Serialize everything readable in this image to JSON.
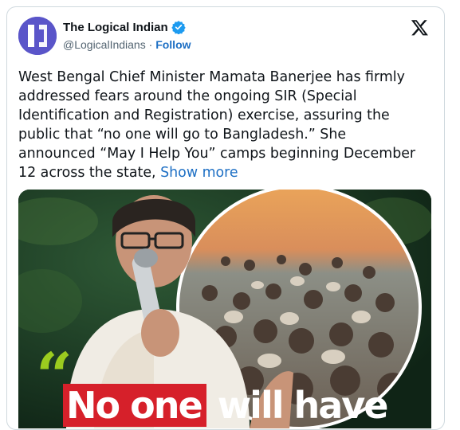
{
  "author": {
    "display_name": "The Logical Indian",
    "handle": "@LogicalIndians",
    "separator": "·",
    "follow_label": "Follow",
    "verified": true,
    "avatar_color": "#5a55c9"
  },
  "platform_logo": "x-logo",
  "tweet": {
    "lines": [
      "West Bengal Chief Minister Mamata Banerjee has firmly",
      "addressed fears around the ongoing SIR (Special",
      "Identification and Registration) exercise, assuring the",
      "public that “no one will go to Bangladesh.” She",
      "announced “May I Help You” camps beginning December"
    ],
    "last_line": "12 across the state,",
    "show_more_label": "Show more"
  },
  "media": {
    "headline_highlight": "No one",
    "headline_rest": "will have",
    "quote_mark": "“",
    "accent_color": "#d6202a",
    "quote_color": "#9ccc1f"
  },
  "colors": {
    "link": "#1d6fc4",
    "text": "#0f1419",
    "muted": "#536471",
    "border": "#cfd9de"
  }
}
